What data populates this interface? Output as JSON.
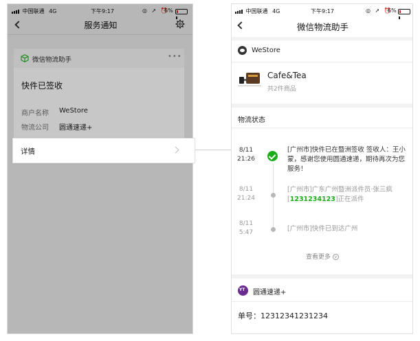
{
  "colors": {
    "accent_green": "#1aad19",
    "battery_red": "#e02020",
    "overlay_gray": "#bdbdbd"
  },
  "left_screen": {
    "status": {
      "carrier": "中国联通",
      "network": "4G",
      "time": "下午9:17",
      "battery": "6%"
    },
    "nav": {
      "title": "服务通知",
      "back_icon": "chevron-left-icon",
      "settings_icon": "gear-icon"
    },
    "card": {
      "app_name": "微信物流助手",
      "more_icon": "more-dots-icon",
      "headline": "快件已签收",
      "fields": [
        {
          "label": "商户名称",
          "value": "WeStore"
        },
        {
          "label": "物流公司",
          "value": "圆通速递+"
        }
      ],
      "detail_label": "详情"
    }
  },
  "right_screen": {
    "status": {
      "carrier": "中国联通",
      "network": "4G",
      "time": "下午9:17",
      "battery": "6%"
    },
    "nav": {
      "title": "微信物流助手",
      "back_icon": "chevron-left-icon"
    },
    "store": {
      "name": "WeStore"
    },
    "product": {
      "name": "Cafe&Tea",
      "count": "共2件商品"
    },
    "status_section_title": "物流状态",
    "timeline": [
      {
        "date": "8/11",
        "time": "21:26",
        "text_parts": [
          "[广州市]快件已在暨洲签收  签收人：王小蒙，感谢您使用圆通速递，期待再次为您服务！"
        ],
        "active": true
      },
      {
        "date": "8/11",
        "time": "21:24",
        "text_pre": "[广州市]广东广州暨洲派件员·张三疯 [",
        "tracking": "1231234123",
        "text_post": "]正在派件",
        "active": false
      },
      {
        "date": "8/11",
        "time": "5:47",
        "text_parts": [
          "[广州市]快件已到达广州"
        ],
        "active": false
      }
    ],
    "see_more": "查看更多",
    "carrier": {
      "name": "圆通速递+",
      "tracking_label": "单号：",
      "tracking_number": "12312341231234"
    }
  }
}
